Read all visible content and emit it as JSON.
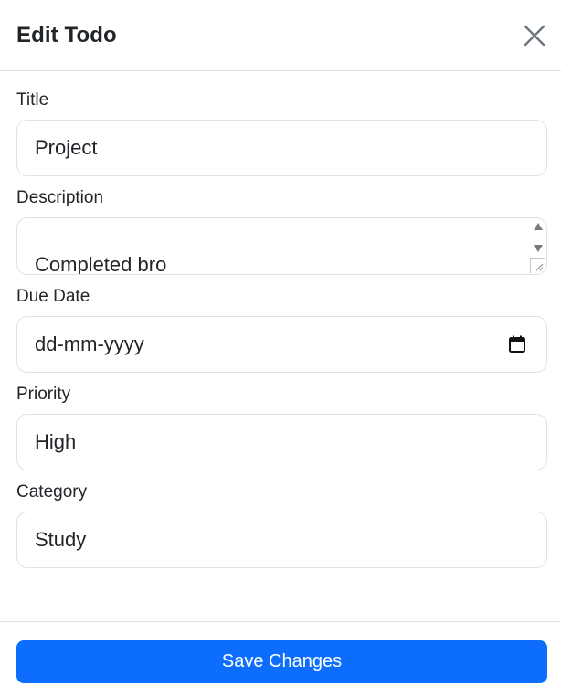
{
  "header": {
    "title": "Edit Todo",
    "close_icon": "close-icon"
  },
  "form": {
    "title": {
      "label": "Title",
      "value": "Project"
    },
    "description": {
      "label": "Description",
      "value": "Completed bro"
    },
    "due_date": {
      "label": "Due Date",
      "value": "dd-mm-yyyy",
      "icon": "calendar-icon"
    },
    "priority": {
      "label": "Priority",
      "value": "High"
    },
    "category": {
      "label": "Category",
      "value": "Study"
    }
  },
  "footer": {
    "save_label": "Save Changes"
  },
  "colors": {
    "accent": "#0d6efd",
    "border": "#dee2e6",
    "text": "#212529"
  }
}
